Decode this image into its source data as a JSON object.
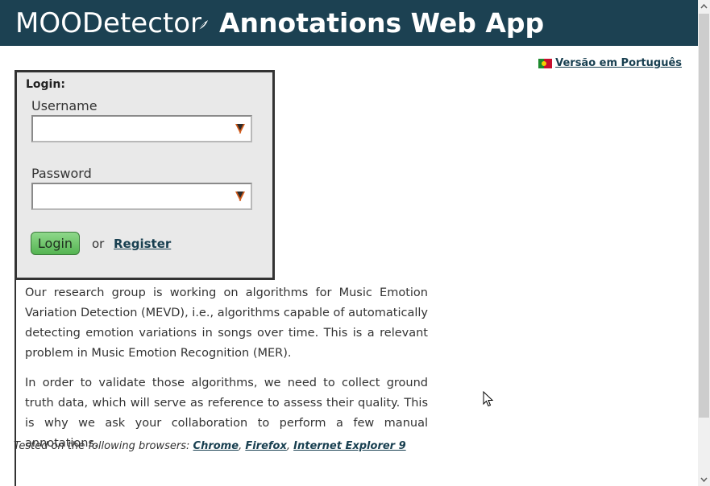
{
  "header": {
    "brand": "MOODetector",
    "feather_icon": "feather-icon",
    "app_title": "Annotations Web App",
    "background": "#1c4152"
  },
  "language": {
    "link_label": "Versão em Português",
    "flag_icon": "portugal-flag-icon"
  },
  "login": {
    "heading": "Login:",
    "username_label": "Username",
    "username_value": "",
    "password_label": "Password",
    "password_value": "",
    "field_icon": "password-manager-icon",
    "submit_label": "Login",
    "or_text": "or",
    "register_label": "Register",
    "button_color": "#55b452"
  },
  "content": {
    "paragraph1": "Our research group is working on algorithms for Music Emotion Variation Detection (MEVD), i.e., algorithms capable of automatically detecting emotion variations in songs over time. This is a relevant problem in Music Emotion Recognition (MER).",
    "paragraph2": "In order to validate those algorithms, we need to collect ground truth data, which will serve as reference to assess their quality. This is why we ask your collaboration to perform a few manual annotations."
  },
  "browsers": {
    "prefix": "Tested on the following browsers: ",
    "items": [
      "Chrome",
      "Firefox",
      "Internet Explorer 9"
    ],
    "separator": ", "
  },
  "link_color": "#183f50"
}
